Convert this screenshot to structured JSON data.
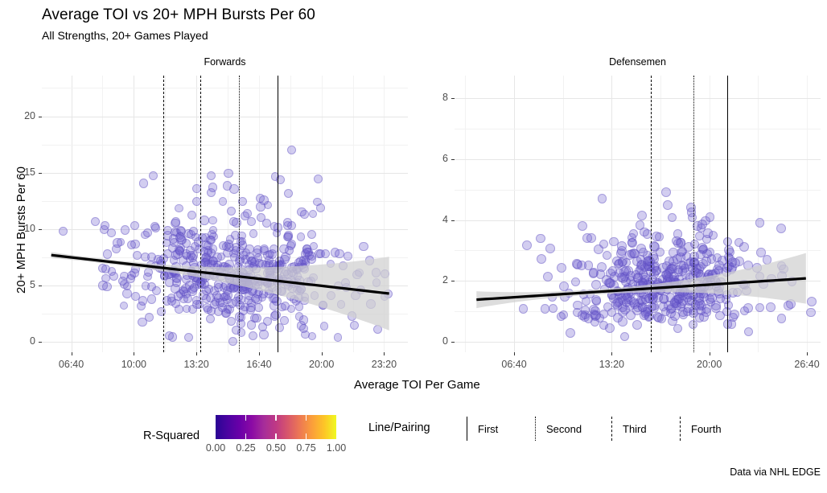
{
  "header": {
    "title": "Average TOI vs 20+ MPH Bursts Per 60",
    "subtitle": "All Strengths, 20+ Games Played",
    "caption": "Data via NHL EDGE"
  },
  "axes": {
    "x_title": "Average TOI Per Game",
    "y_title": "20+ MPH Bursts Per 60"
  },
  "legend": {
    "rsquared_title": "R-Squared",
    "rsquared_ticks": [
      "0.00",
      "0.25",
      "0.50",
      "0.75",
      "1.00"
    ],
    "linepairing_title": "Line/Pairing",
    "linepairing_keys": [
      {
        "label": "First",
        "style": "solid"
      },
      {
        "label": "Second",
        "style": "dotted"
      },
      {
        "label": "Third",
        "style": "dashed"
      },
      {
        "label": "Fourth",
        "style": "dashed"
      }
    ],
    "colorbar_colors": [
      "#2a0594",
      "#6a00a8",
      "#bf3984",
      "#ed7953",
      "#f0f921"
    ]
  },
  "chart_data": {
    "type": "scatter",
    "title": "Average TOI vs 20+ MPH Bursts Per 60",
    "subtitle": "All Strengths, 20+ Games Played",
    "caption": "Data via NHL EDGE",
    "xlabel": "Average TOI Per Game",
    "ylabel": "20+ MPH Bursts Per 60",
    "point_color": "#6a5acd",
    "point_alpha": 0.3,
    "trend_color": "#000000",
    "ribbon_color": "#d0d0d0",
    "facets": [
      {
        "name": "Forwards",
        "xticks": [
          "06:40",
          "10:00",
          "13:20",
          "16:40",
          "20:00",
          "23:20"
        ],
        "xtick_minutes": [
          6.667,
          10.0,
          13.333,
          16.667,
          20.0,
          23.333
        ],
        "xlim_minutes": [
          5.1,
          24.6
        ],
        "yticks": [
          0,
          5,
          10,
          15,
          20
        ],
        "ylim": [
          -0.9,
          23.6
        ],
        "n_points": 560,
        "trend": {
          "x_start_min": 5.6,
          "y_start": 7.7,
          "x_end_min": 23.6,
          "y_end": 4.3
        },
        "reflines": [
          {
            "label": "Fourth",
            "style": "dashed",
            "x_minutes": 11.55
          },
          {
            "label": "Third",
            "style": "dashed",
            "x_minutes": 13.55
          },
          {
            "label": "Second",
            "style": "dotted",
            "x_minutes": 15.6
          },
          {
            "label": "First",
            "style": "solid",
            "x_minutes": 17.65
          }
        ]
      },
      {
        "name": "Defensemen",
        "xticks": [
          "06:40",
          "13:20",
          "20:00",
          "26:40"
        ],
        "xtick_minutes": [
          6.667,
          13.333,
          20.0,
          26.667
        ],
        "xlim_minutes": [
          2.6,
          27.6
        ],
        "yticks": [
          0,
          2,
          4,
          6,
          8
        ],
        "ylim": [
          -0.35,
          8.75
        ],
        "n_points": 470,
        "trend": {
          "x_start_min": 4.1,
          "y_start": 1.38,
          "x_end_min": 26.6,
          "y_end": 2.08
        },
        "reflines": [
          {
            "label": "Third",
            "style": "dashed",
            "x_minutes": 16.0
          },
          {
            "label": "Second",
            "style": "dotted",
            "x_minutes": 18.9
          },
          {
            "label": "First",
            "style": "solid",
            "x_minutes": 21.2
          }
        ]
      }
    ]
  }
}
